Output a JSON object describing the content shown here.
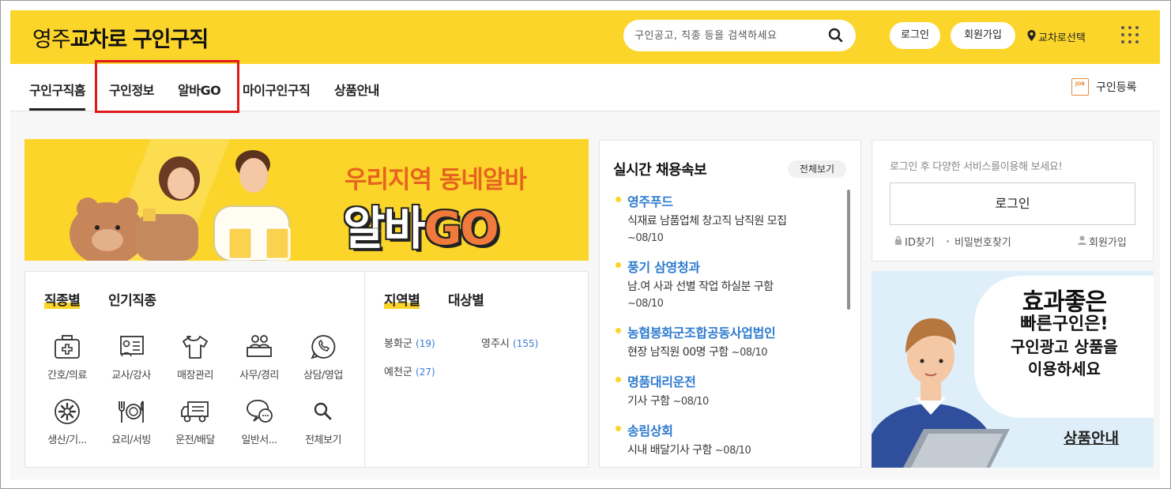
{
  "header": {
    "logo_light": "영주",
    "logo_bold": "교차로",
    "logo_suffix": "구인구직",
    "search_placeholder": "구인공고, 직종 등을 검색하세요",
    "login_label": "로그인",
    "signup_label": "회원가입",
    "location_label": "교차로선택",
    "icons": [
      "search-icon",
      "location-pin-icon",
      "grid-menu-icon"
    ],
    "brand_color": "#fcd52a"
  },
  "nav": {
    "items": [
      {
        "label": "구인구직홈",
        "active": true
      },
      {
        "label": "구인정보",
        "active": false
      },
      {
        "label": "알바GO",
        "active": false
      },
      {
        "label": "마이구인구직",
        "active": false
      },
      {
        "label": "상품안내",
        "active": false
      }
    ],
    "register_label": "구인등록",
    "register_icon_text": "JOB",
    "highlight_color": "#e0191b"
  },
  "banner": {
    "subtitle": "우리지역 동네알바",
    "title_main": "알바",
    "title_accent": "GO"
  },
  "categories": {
    "tabs": [
      {
        "label": "직종별",
        "active": true
      },
      {
        "label": "인기직종",
        "active": false
      }
    ],
    "items": [
      {
        "label": "간호/의료",
        "icon": "medical-kit-icon"
      },
      {
        "label": "교사/강사",
        "icon": "teacher-board-icon"
      },
      {
        "label": "매장관리",
        "icon": "shirt-icon"
      },
      {
        "label": "사무/경리",
        "icon": "office-desk-icon"
      },
      {
        "label": "상담/영업",
        "icon": "phone-chat-icon"
      },
      {
        "label": "생산/기...",
        "icon": "gear-icon"
      },
      {
        "label": "요리/서빙",
        "icon": "dining-icon"
      },
      {
        "label": "운전/배달",
        "icon": "truck-icon"
      },
      {
        "label": "일반서...",
        "icon": "chat-bubbles-icon"
      },
      {
        "label": "전체보기",
        "icon": "search-icon"
      }
    ]
  },
  "regions": {
    "tabs": [
      {
        "label": "지역별",
        "active": true
      },
      {
        "label": "대상별",
        "active": false
      }
    ],
    "items": [
      {
        "name": "봉화군",
        "count": "(19)"
      },
      {
        "name": "영주시",
        "count": "(155)"
      },
      {
        "name": "예천군",
        "count": "(27)"
      }
    ]
  },
  "realtime": {
    "title": "실시간 채용속보",
    "view_all": "전체보기",
    "items": [
      {
        "company": "영주푸드",
        "desc": "식재료 남품업체 창고직 남직원 모집",
        "date": "~08/10"
      },
      {
        "company": "풍기 삼영청과",
        "desc": "남.여 사과 선별 작업 하실분 구함",
        "date": "~08/10"
      },
      {
        "company": "농협봉화군조합공동사업법인",
        "desc": "현장 남직원 00명 구함",
        "date": "~08/10"
      },
      {
        "company": "명품대리운전",
        "desc": "기사 구함",
        "date": "~08/10"
      },
      {
        "company": "송림상회",
        "desc": "시내 배달기사 구함",
        "date": "~08/10"
      }
    ]
  },
  "login_panel": {
    "hint": "로그인 후 다양한 서비스를이용해 보세요!",
    "login_button": "로그인",
    "find_id": "ID찾기",
    "find_password": "비밀번호찾기",
    "signup": "회원가입"
  },
  "ad": {
    "line1": "효과좋은",
    "line2": "빠른구인은!",
    "line3": "구인광고 상품을",
    "line4": "이용하세요",
    "link": "상품안내"
  }
}
